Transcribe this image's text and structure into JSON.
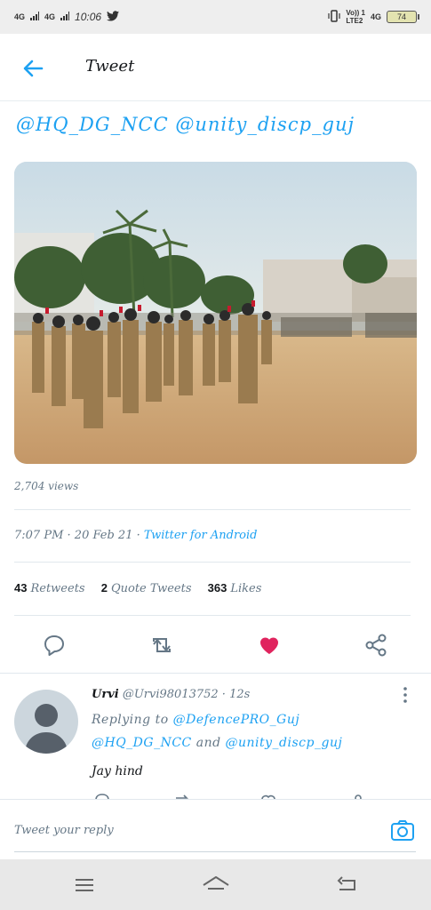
{
  "status_bar": {
    "network1": "4G",
    "network2": "4G",
    "time": "10:06",
    "lte_label": "Vo)) 1\nLTE2",
    "network3": "4G",
    "battery": "74"
  },
  "header": {
    "title": "Tweet"
  },
  "tweet": {
    "truncated_mentions": "@HQ_DG_NCC @unity_discp_guj",
    "views": "2,704 views",
    "time": "7:07 PM",
    "date": "20 Feb 21",
    "source": "Twitter for Android",
    "separator": " · ",
    "retweets_count": "43",
    "retweets_label": "Retweets",
    "quote_count": "2",
    "quote_label": "Quote Tweets",
    "likes_count": "363",
    "likes_label": "Likes",
    "liked": true,
    "colors": {
      "accent": "#1da1f2",
      "like": "#e0245e",
      "secondary_text": "#657786"
    }
  },
  "actions": [
    {
      "name": "reply-icon"
    },
    {
      "name": "retweet-icon"
    },
    {
      "name": "like-icon"
    },
    {
      "name": "share-icon"
    }
  ],
  "reply": {
    "author_name": "Urvi",
    "author_handle": "@Urvi98013752",
    "time_ago": "12s",
    "dot": " · ",
    "replying_prefix": "Replying to",
    "replying_handle_1": "@DefencePRO_Guj",
    "replying_handle_2": "@HQ_DG_NCC",
    "and_word": "and",
    "replying_handle_3": "@unity_discp_guj",
    "text": "Jay hind"
  },
  "composer": {
    "placeholder": "Tweet your reply"
  },
  "nav_bar": {
    "icons": [
      "menu-icon",
      "home-icon",
      "back-nav-icon"
    ]
  }
}
